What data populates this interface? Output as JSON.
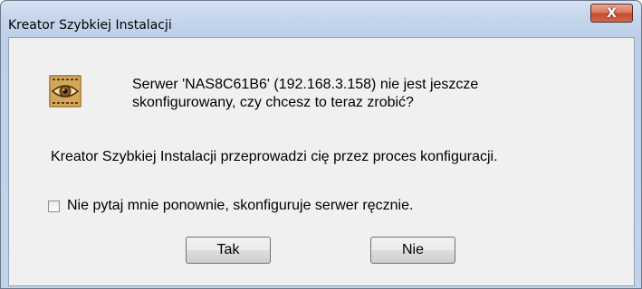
{
  "window": {
    "title": "Kreator Szybkiej Instalacji",
    "close_label": "X"
  },
  "dialog": {
    "icon": "eye-scan-icon",
    "message_line1": "Serwer 'NAS8C61B6' (192.168.3.158) nie jest jeszcze",
    "message_line2": "skonfigurowany, czy chcesz to teraz zrobić?",
    "info": "Kreator Szybkiej Instalacji przeprowadzi cię przez proces konfiguracji.",
    "checkbox_label": "Nie pytaj mnie ponownie, skonfiguruje serwer ręcznie.",
    "checkbox_checked": false,
    "yes_label": "Tak",
    "no_label": "Nie"
  },
  "colors": {
    "close_button": "#c34b2d",
    "client_bg": "#f0f0f0",
    "frame": "#c6d7ec"
  }
}
